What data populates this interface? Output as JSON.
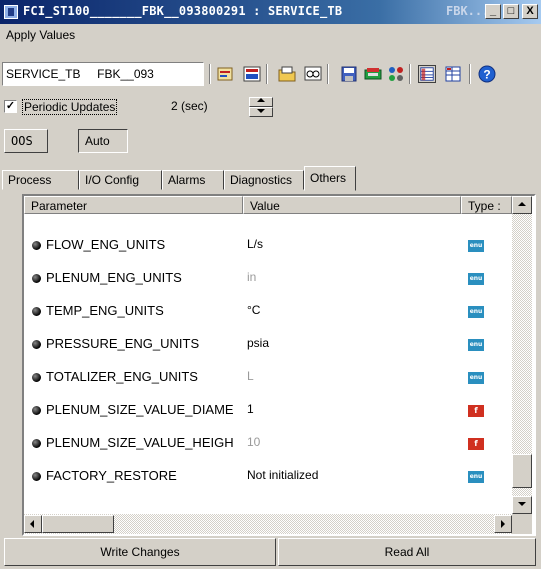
{
  "window": {
    "title": "FCI_ST100_______FBK__093800291 : SERVICE_TB",
    "title_suffix": "FBK...",
    "minimize": "_",
    "maximize": "□",
    "close": "X"
  },
  "menu": {
    "apply_values": "Apply Values"
  },
  "toolbar": {
    "block_selector": "SERVICE_TB     FBK__093",
    "icons": [
      "edit-icon",
      "edit-all-icon",
      "folder-icon",
      "view-icon",
      "save-icon",
      "device-icon",
      "tag-icon",
      "table-icon",
      "grid-icon",
      "help-icon"
    ]
  },
  "periodic": {
    "label": "Periodic Updates",
    "checked": true,
    "checkmark": "✓",
    "interval": "2 (sec)"
  },
  "mode": {
    "oos": "OOS",
    "auto": "Auto"
  },
  "tabs": [
    "Process",
    "I/O Config",
    "Alarms",
    "Diagnostics",
    "Others"
  ],
  "active_tab": "Others",
  "grid": {
    "headers": {
      "parameter": "Parameter",
      "value": "Value",
      "type": "Type :"
    },
    "rows": [
      {
        "name": "FLOW_ENG_UNITS",
        "value": "L/s",
        "muted": false,
        "type": "enu"
      },
      {
        "name": "PLENUM_ENG_UNITS",
        "value": "in",
        "muted": true,
        "type": "enu"
      },
      {
        "name": "TEMP_ENG_UNITS",
        "value": "°C",
        "muted": false,
        "type": "enu"
      },
      {
        "name": "PRESSURE_ENG_UNITS",
        "value": "psia",
        "muted": false,
        "type": "enu"
      },
      {
        "name": "TOTALIZER_ENG_UNITS",
        "value": "L",
        "muted": true,
        "type": "enu"
      },
      {
        "name": "PLENUM_SIZE_VALUE_DIAME",
        "value": "1",
        "muted": false,
        "type": "f"
      },
      {
        "name": "PLENUM_SIZE_VALUE_HEIGH",
        "value": "10",
        "muted": true,
        "type": "f"
      },
      {
        "name": "FACTORY_RESTORE",
        "value": "Not initialized",
        "muted": false,
        "type": "enu"
      }
    ]
  },
  "buttons": {
    "write_changes": "Write Changes",
    "read_all": "Read All"
  },
  "colors": {
    "enu_icon": "#2a8fbf",
    "float_icon": "#d03020",
    "title_bar": "#0a246a"
  }
}
